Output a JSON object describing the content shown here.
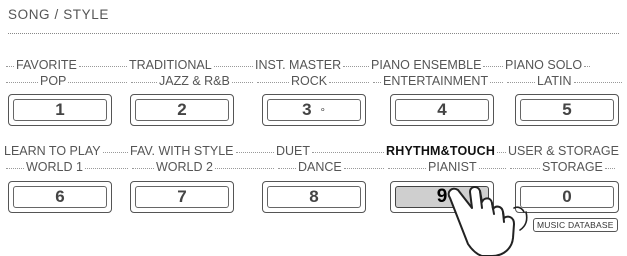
{
  "section_title": "SONG / STYLE",
  "rows": [
    {
      "labels_top": [
        "FAVORITE",
        "TRADITIONAL",
        "INST. MASTER",
        "PIANO ENSEMBLE",
        "PIANO SOLO"
      ],
      "labels_bottom": [
        "POP",
        "JAZZ & R&B",
        "ROCK",
        "ENTERTAINMENT",
        "LATIN"
      ],
      "keys": [
        "1",
        "2",
        "3",
        "4",
        "5"
      ]
    },
    {
      "labels_top": [
        "LEARN TO PLAY",
        "FAV. WITH STYLE",
        "DUET",
        "RHYTHM&TOUCH",
        "USER & STORAGE"
      ],
      "labels_bottom": [
        "WORLD 1",
        "WORLD 2",
        "DANCE",
        "PIANIST",
        "STORAGE"
      ],
      "keys": [
        "6",
        "7",
        "8",
        "9",
        "0"
      ]
    }
  ],
  "key3_indicator": "∘",
  "pressed_key": "9",
  "music_database_label": "MUSIC DATABASE",
  "icons": {
    "finger": "pressing-finger-hand-icon"
  }
}
